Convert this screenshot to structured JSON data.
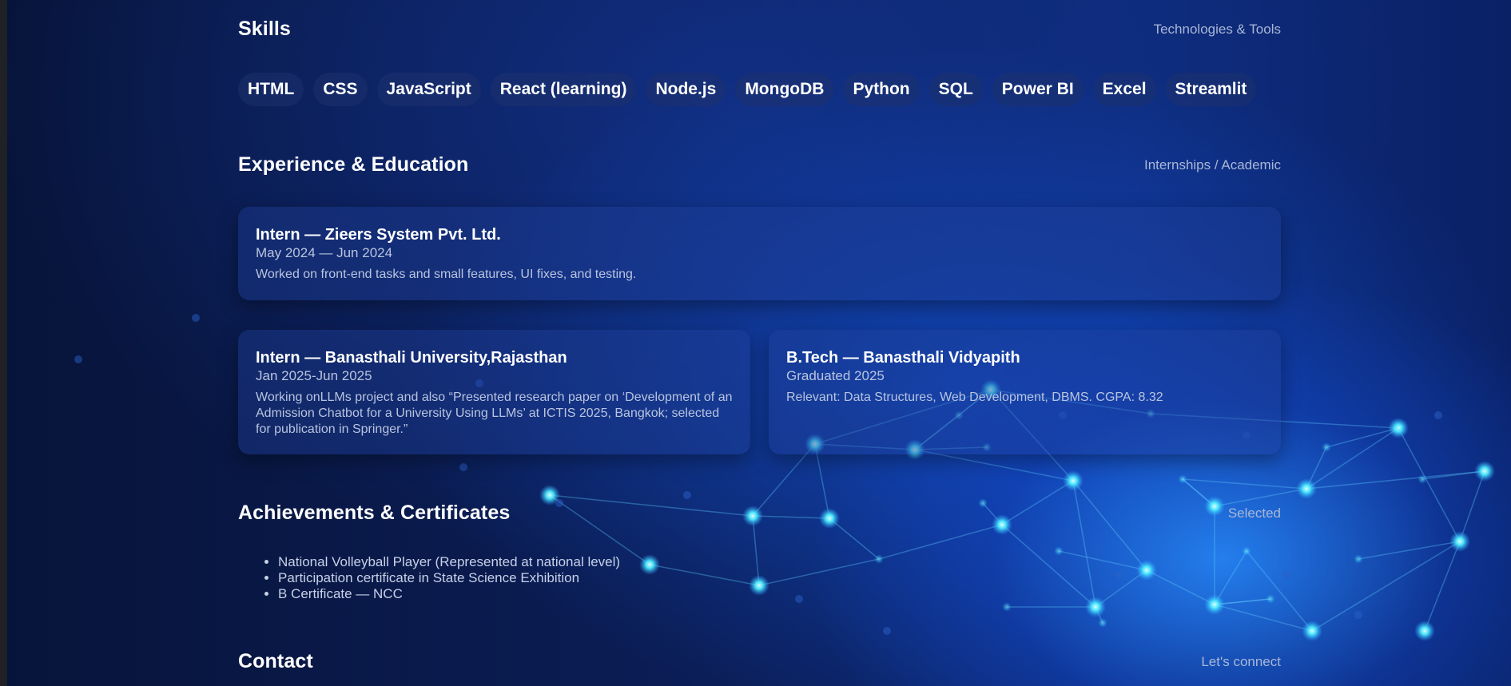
{
  "skills": {
    "title": "Skills",
    "subtitle": "Technologies & Tools",
    "items": [
      "HTML",
      "CSS",
      "JavaScript",
      "React (learning)",
      "Node.js",
      "MongoDB",
      "Python",
      "SQL",
      "Power BI",
      "Excel",
      "Streamlit"
    ]
  },
  "experience": {
    "title": "Experience & Education",
    "subtitle": "Internships / Academic",
    "cards": [
      {
        "title": "Intern — Zieers System Pvt. Ltd.",
        "date": "May 2024 — Jun 2024",
        "text": "Worked on front-end tasks and small features, UI fixes, and testing."
      },
      {
        "title": "Intern — Banasthali University,Rajasthan",
        "date": "Jan 2025-Jun 2025",
        "text": "Working onLLMs project and also “Presented research paper on ‘Development of an Admission Chatbot for a University Using LLMs’ at ICTIS 2025, Bangkok; selected for publication in Springer.”"
      },
      {
        "title": "B.Tech — Banasthali Vidyapith",
        "date": "Graduated 2025",
        "text": "Relevant: Data Structures, Web Development, DBMS. CGPA: 8.32"
      }
    ]
  },
  "achievements": {
    "title": "Achievements & Certificates",
    "subtitle": "Selected",
    "items": [
      "National Volleyball Player (Represented at national level)",
      "Participation certificate in State Science Exhibition",
      "B Certificate — NCC"
    ]
  },
  "contact": {
    "title": "Contact",
    "subtitle": "Let's connect"
  },
  "colors": {
    "background": "#0a1a44",
    "glow": "#1f8bff",
    "node": "#3fe6ff"
  }
}
